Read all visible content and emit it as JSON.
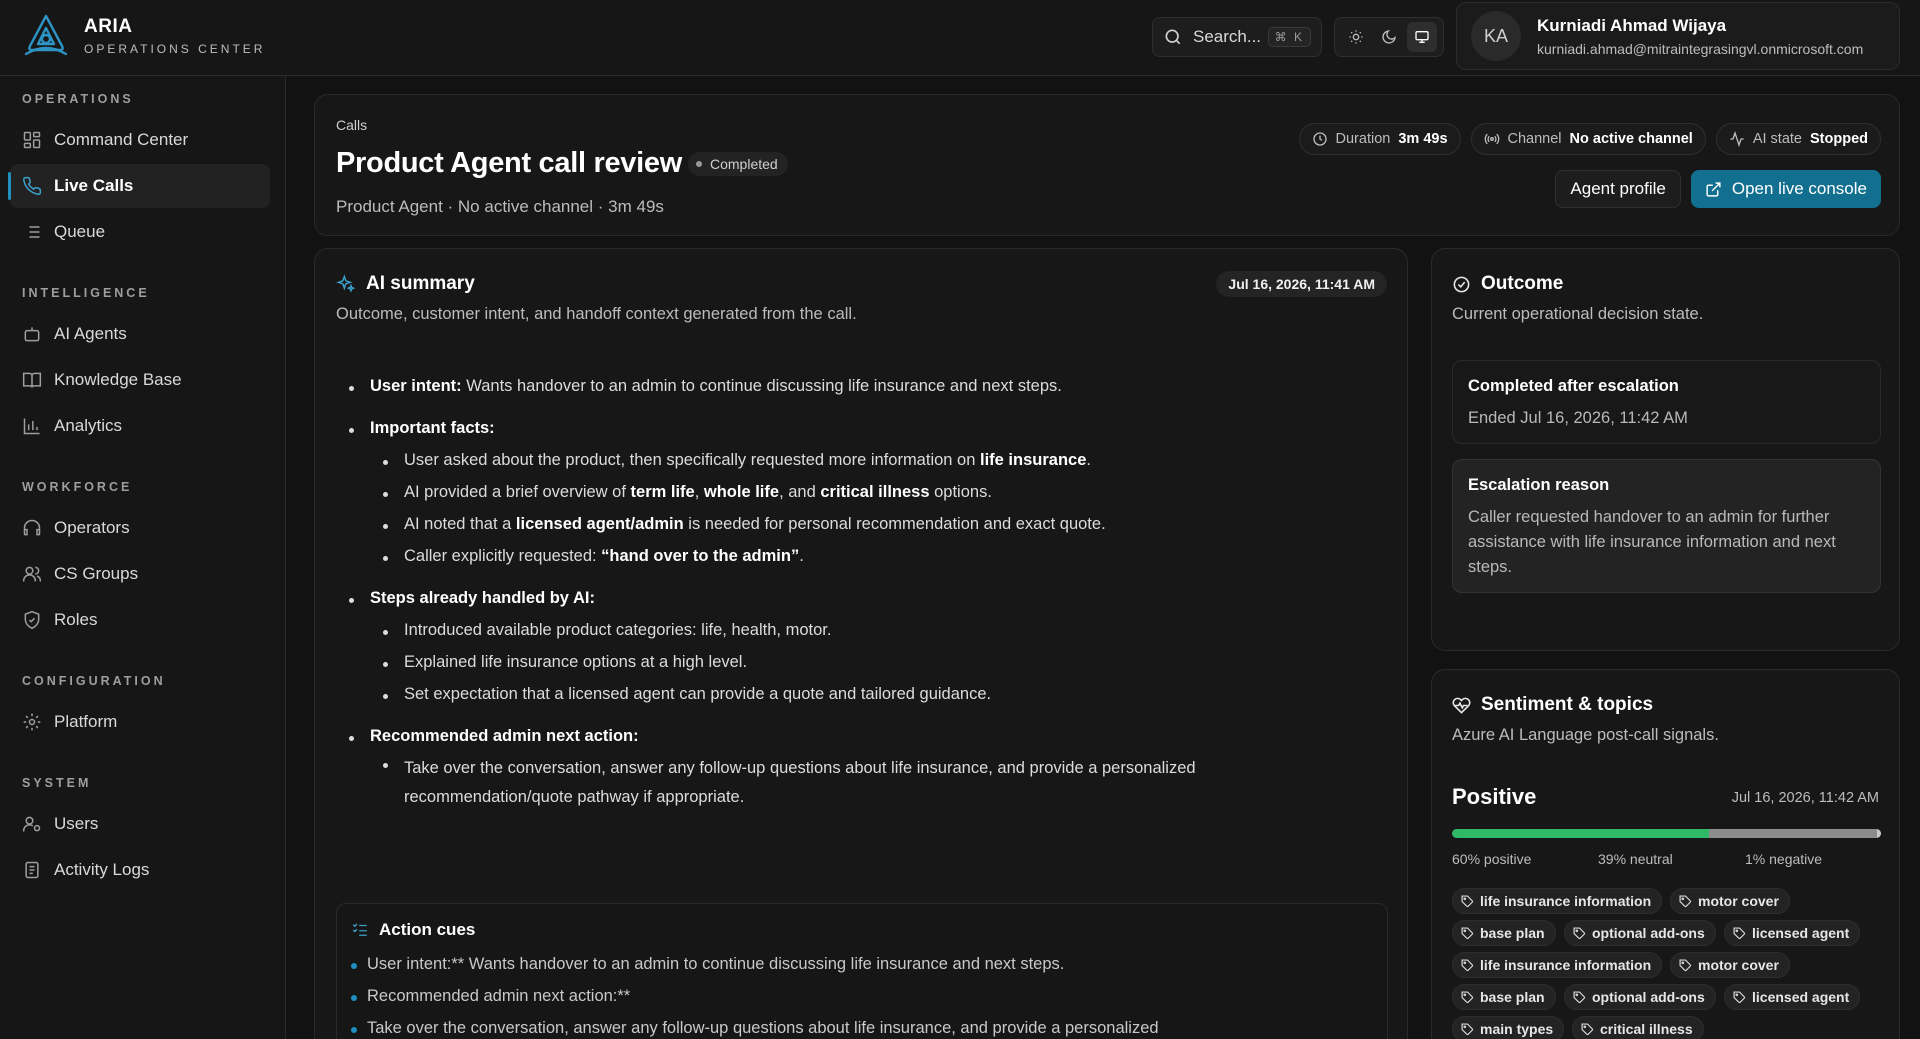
{
  "brand": {
    "title": "ARIA",
    "subtitle": "OPERATIONS CENTER"
  },
  "search": {
    "label": "Search...",
    "shortcut": "⌘ K"
  },
  "theme": {
    "options": [
      "light",
      "dark",
      "system"
    ],
    "selected": "system"
  },
  "user": {
    "initials": "KA",
    "name": "Kurniadi Ahmad Wijaya",
    "email": "kurniadi.ahmad@mitraintegrasingvl.onmicrosoft.com"
  },
  "sidebar": {
    "sections": [
      {
        "title": "OPERATIONS",
        "items": [
          {
            "label": "Command Center",
            "icon": "dashboard-icon"
          },
          {
            "label": "Live Calls",
            "icon": "phone-icon",
            "active": true
          },
          {
            "label": "Queue",
            "icon": "list-icon"
          }
        ]
      },
      {
        "title": "INTELLIGENCE",
        "items": [
          {
            "label": "AI Agents",
            "icon": "bot-icon"
          },
          {
            "label": "Knowledge Base",
            "icon": "book-icon"
          },
          {
            "label": "Analytics",
            "icon": "chart-icon"
          }
        ]
      },
      {
        "title": "WORKFORCE",
        "items": [
          {
            "label": "Operators",
            "icon": "headset-icon"
          },
          {
            "label": "CS Groups",
            "icon": "users-icon"
          },
          {
            "label": "Roles",
            "icon": "shield-icon"
          }
        ]
      },
      {
        "title": "CONFIGURATION",
        "items": [
          {
            "label": "Platform",
            "icon": "gear-icon"
          }
        ]
      },
      {
        "title": "SYSTEM",
        "items": [
          {
            "label": "Users",
            "icon": "user-cog-icon"
          },
          {
            "label": "Activity Logs",
            "icon": "log-icon"
          }
        ]
      }
    ]
  },
  "header": {
    "breadcrumb": "Calls",
    "title": "Product Agent call review",
    "status": "Completed",
    "subtitle": "Product Agent · No active channel · 3m 49s",
    "meta": [
      {
        "label": "Duration",
        "value": "3m 49s",
        "icon": "clock-icon"
      },
      {
        "label": "Channel",
        "value": "No active channel",
        "icon": "radio-icon"
      },
      {
        "label": "AI state",
        "value": "Stopped",
        "icon": "activity-icon"
      }
    ],
    "agent_profile_label": "Agent profile",
    "open_console_label": "Open live console"
  },
  "summary": {
    "title": "AI summary",
    "description": "Outcome, customer intent, and handoff context generated from the call.",
    "date": "Jul 16, 2026, 11:41 AM",
    "user_intent_label": "User intent:",
    "user_intent_text": " Wants handover to an admin to continue discussing life insurance and next steps.",
    "facts_label": "Important facts:",
    "fact1_a": "User asked about the product, then specifically requested more information on ",
    "fact1_b": "life insurance",
    "fact1_c": ".",
    "fact2_a": "AI provided a brief overview of ",
    "fact2_b": "term life",
    "fact2_c": ", ",
    "fact2_d": "whole life",
    "fact2_e": ", and ",
    "fact2_f": "critical illness",
    "fact2_g": " options.",
    "fact3_a": "AI noted that a ",
    "fact3_b": "licensed agent/admin",
    "fact3_c": " is needed for personal recommendation and exact quote.",
    "fact4_a": "Caller explicitly requested: ",
    "fact4_b": "“hand over to the admin”",
    "fact4_c": ".",
    "steps_label": "Steps already handled by AI:",
    "steps": [
      "Introduced available product categories: life, health, motor.",
      "Explained life insurance options at a high level.",
      "Set expectation that a licensed agent can provide a quote and tailored guidance."
    ],
    "next_label": "Recommended admin next action:",
    "next_text_1": "Take over the conversation, answer any follow-up questions about life insurance, and provide a personalized",
    "next_text_2": "recommendation/quote pathway if appropriate."
  },
  "action_cues": {
    "title": "Action cues",
    "items": [
      "User intent:** Wants handover to an admin to continue discussing life insurance and next steps.",
      "Recommended admin next action:**",
      "Take over the conversation, answer any follow-up questions about life insurance, and provide a personalized"
    ]
  },
  "outcome": {
    "title": "Outcome",
    "description": "Current operational decision state.",
    "state_title": "Completed after escalation",
    "state_text": "Ended Jul 16, 2026, 11:42 AM",
    "reason_title": "Escalation reason",
    "reason_text": "Caller requested handover to an admin for further assistance with life insurance information and next steps."
  },
  "sentiment": {
    "title": "Sentiment & topics",
    "description": "Azure AI Language post-call signals.",
    "label": "Positive",
    "date": "Jul 16, 2026, 11:42 AM",
    "positive_pct": 60,
    "neutral_pct": 39,
    "negative_pct": 1,
    "positive_text": "60% positive",
    "neutral_text": "39% neutral",
    "negative_text": "1% negative",
    "colors": {
      "positive": "#2fb866",
      "neutral": "#8c8c8c",
      "negative": "#c8c8c8"
    },
    "topics": [
      "life insurance information",
      "motor cover",
      "base plan",
      "optional add-ons",
      "licensed agent",
      "life insurance information",
      "motor cover",
      "base plan",
      "optional add-ons",
      "licensed agent",
      "main types",
      "critical illness"
    ]
  }
}
